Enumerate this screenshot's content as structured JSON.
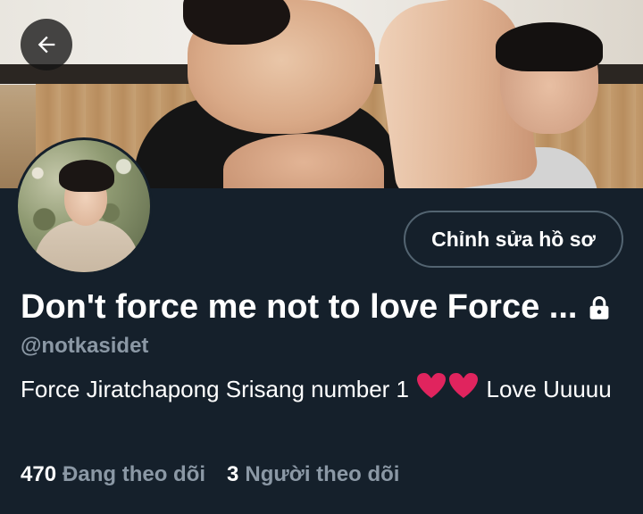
{
  "header": {
    "back_icon": "arrow-left-icon"
  },
  "profile": {
    "edit_button_label": "Chỉnh sửa hồ sơ",
    "display_name": "Don't force me not to love Force ...",
    "lock_icon": "lock-icon",
    "handle": "@notkasidet",
    "bio_text": "Force Jiratchapong Srisang number 1",
    "bio_hearts": "❤❤",
    "bio_tail": "Love Uuuuu"
  },
  "stats": {
    "following_count": "470",
    "following_label": "Đang theo dõi",
    "followers_count": "3",
    "followers_label": "Người theo dõi"
  },
  "colors": {
    "background": "#15202b",
    "secondary_text": "#8b98a5",
    "button_border": "#536471",
    "heart": "#e0245e"
  }
}
